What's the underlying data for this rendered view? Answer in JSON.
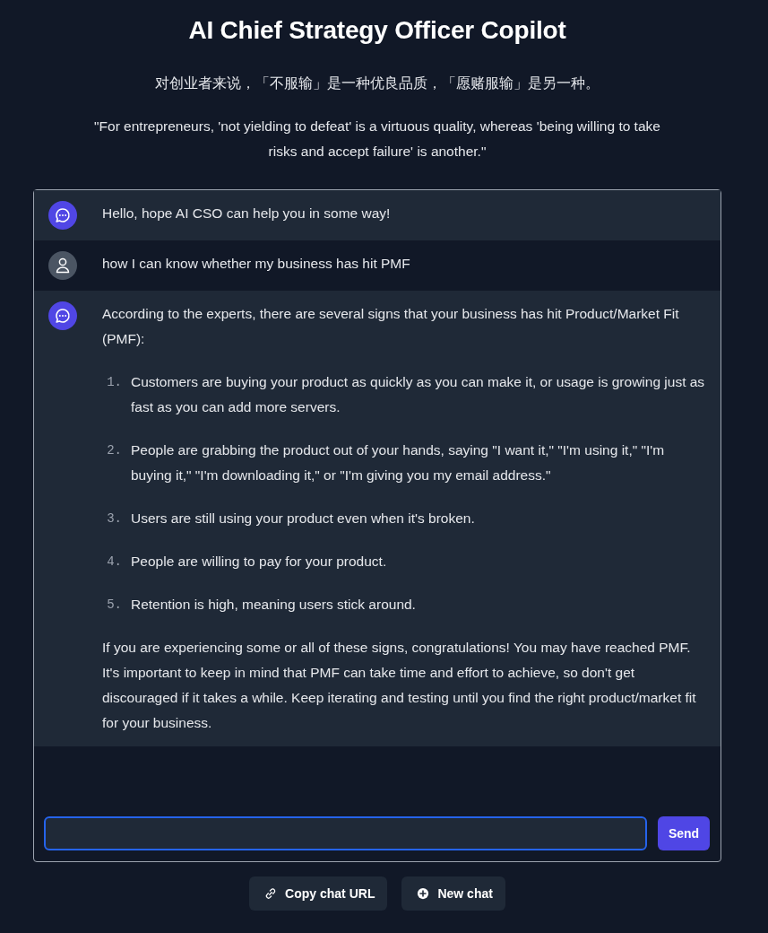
{
  "title": "AI Chief Strategy Officer Copilot",
  "quote_zh": "对创业者来说，「不服输」是一种优良品质，「愿赌服输」是另一种。",
  "quote_en": "\"For entrepreneurs, 'not yielding to defeat' is a virtuous quality, whereas 'being willing to take risks and accept failure' is another.\"",
  "messages": [
    {
      "kind": "assistant",
      "blocks": [
        {
          "kind": "paragraph",
          "text": "Hello, hope AI CSO can help you in some way!"
        }
      ]
    },
    {
      "kind": "user",
      "blocks": [
        {
          "kind": "paragraph",
          "text": "how I can know whether my business has hit PMF"
        }
      ]
    },
    {
      "kind": "assistant",
      "blocks": [
        {
          "kind": "paragraph",
          "text": "According to the experts, there are several signs that your business has hit Product/Market Fit (PMF):"
        },
        {
          "kind": "list",
          "items": [
            {
              "number": "1.",
              "text": "Customers are buying your product as quickly as you can make it, or usage is growing just as fast as you can add more servers."
            },
            {
              "number": "2.",
              "text": "People are grabbing the product out of your hands, saying \"I want it,\" \"I'm using it,\" \"I'm buying it,\" \"I'm downloading it,\" or \"I'm giving you my email address.\""
            },
            {
              "number": "3.",
              "text": "Users are still using your product even when it's broken."
            },
            {
              "number": "4.",
              "text": "People are willing to pay for your product."
            },
            {
              "number": "5.",
              "text": "Retention is high, meaning users stick around."
            }
          ]
        },
        {
          "kind": "paragraph",
          "text": "If you are experiencing some or all of these signs, congratulations! You may have reached PMF. It's important to keep in mind that PMF can take time and effort to achieve, so don't get discouraged if it takes a while. Keep iterating and testing until you find the right product/market fit for your business."
        }
      ]
    }
  ],
  "composer": {
    "focused": true,
    "send_button": "Send"
  },
  "actions": [
    {
      "kind": "link",
      "label": "Copy chat URL"
    },
    {
      "kind": "plus",
      "label": "New chat"
    }
  ]
}
